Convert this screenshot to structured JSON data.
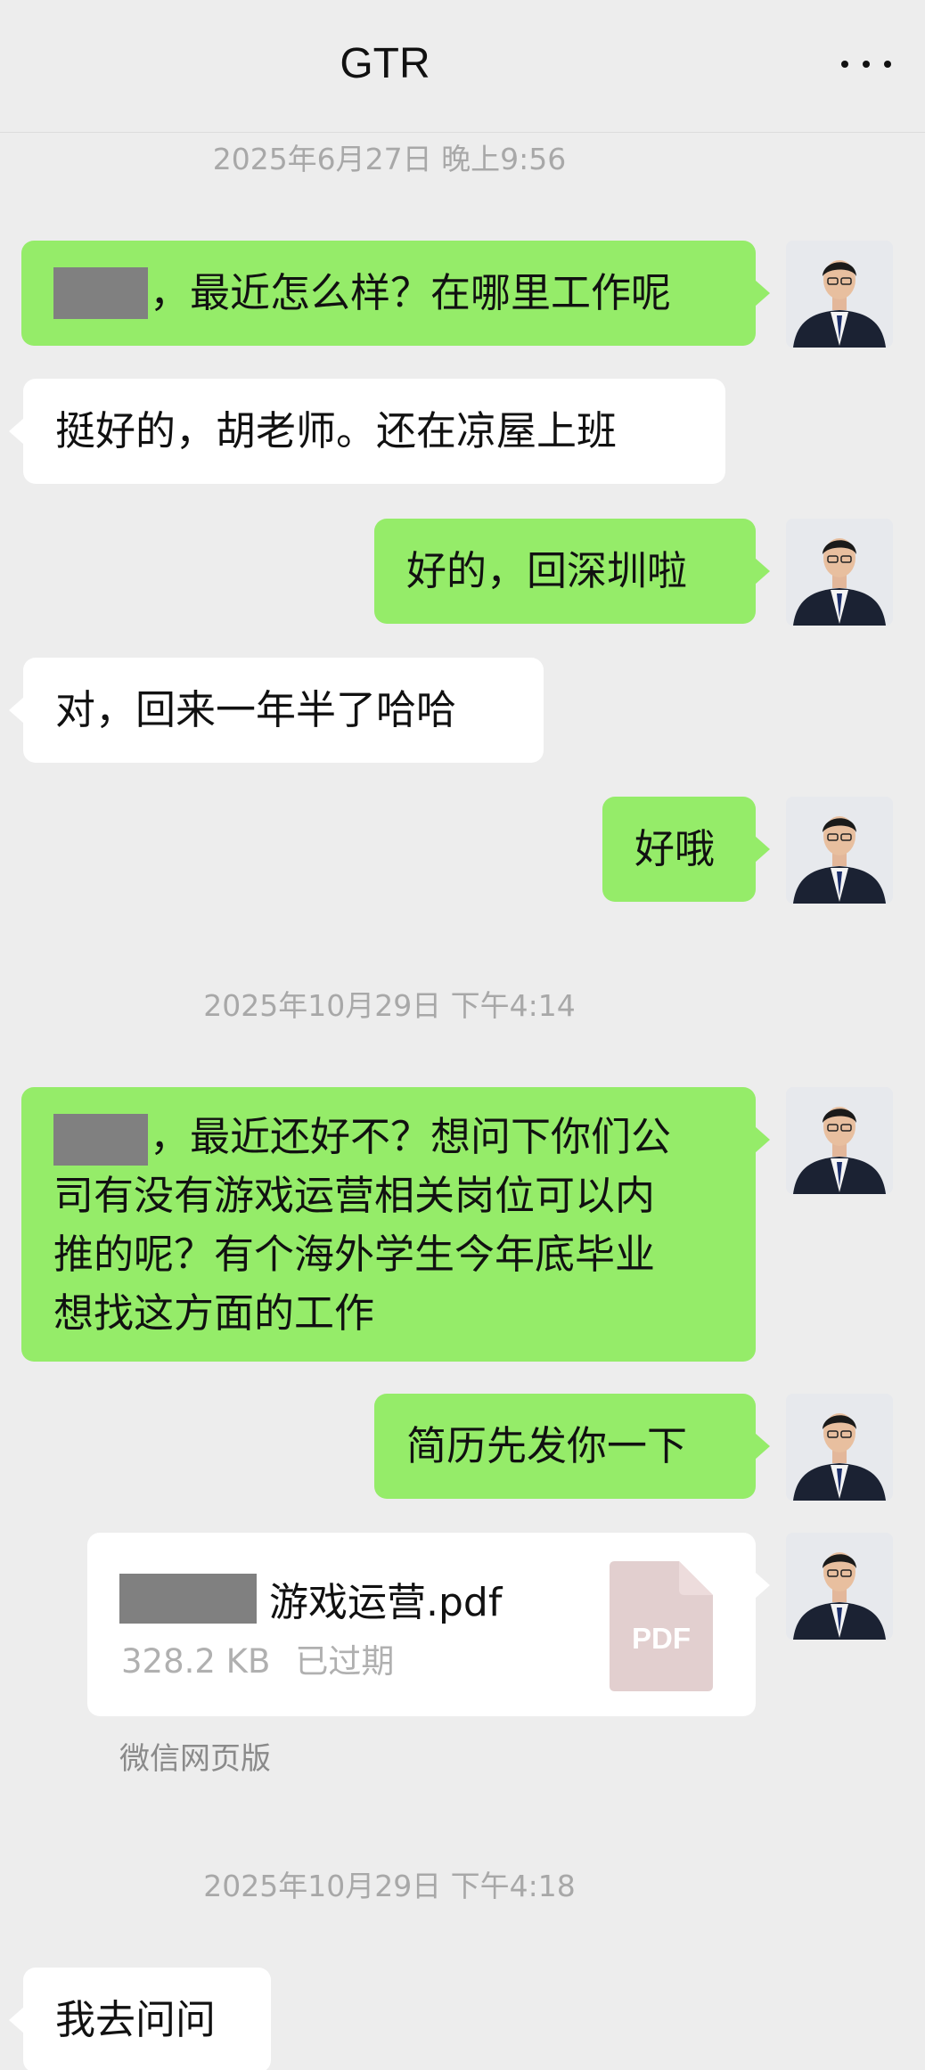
{
  "header": {
    "title": "GTR",
    "more_icon": "more-dots-icon"
  },
  "timestamps": [
    "2025年6月27日 晚上9:56",
    "2025年10月29日 下午4:14",
    "2025年10月29日 下午4:18"
  ],
  "messages": {
    "m1": {
      "side": "sent",
      "text": "，最近怎么样？在哪里工作呢",
      "has_redaction": true
    },
    "m2": {
      "side": "received",
      "text": "挺好的，胡老师。还在凉屋上班"
    },
    "m3": {
      "side": "sent",
      "text": "好的，回深圳啦"
    },
    "m4": {
      "side": "received",
      "text": "对，回来一年半了哈哈"
    },
    "m5": {
      "side": "sent",
      "text": "好哦"
    },
    "m6": {
      "side": "sent",
      "has_redaction": true,
      "lines": [
        "，最近还好不？想问下你们公",
        "司有没有游戏运营相关岗位可以内",
        "推的呢？有个海外学生今年底毕业",
        "想找这方面的工作"
      ]
    },
    "m7": {
      "side": "sent",
      "text": "简历先发你一下"
    },
    "m8": {
      "side": "received",
      "text": "我去问问"
    }
  },
  "file": {
    "name": "游戏运营.pdf",
    "size": "328.2 KB",
    "status": "已过期",
    "icon_label": "PDF",
    "source": "微信网页版"
  },
  "colors": {
    "background": "#ededed",
    "sent_bubble": "#95ec69",
    "received_bubble": "#ffffff",
    "timestamp_text": "#a8a8a8",
    "pdf_icon": "#e2cfcf"
  }
}
